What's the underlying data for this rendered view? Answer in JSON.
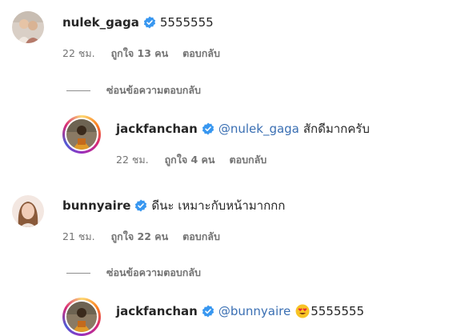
{
  "comments": [
    {
      "username": "nulek_gaga",
      "text": "5555555",
      "time": "22 ชม.",
      "likes": "ถูกใจ 13 คน",
      "reply": "ตอบกลับ",
      "hide_replies": "ซ่อนข้อความตอบกลับ",
      "replies": [
        {
          "username": "jackfanchan",
          "mention": "@nulek_gaga",
          "text": "สักดีมากครับ",
          "time": "22 ชม.",
          "likes": "ถูกใจ 4 คน",
          "reply": "ตอบกลับ"
        }
      ]
    },
    {
      "username": "bunnyaire",
      "text": "ดีนะ เหมาะกับหน้ามากกก",
      "time": "21 ชม.",
      "likes": "ถูกใจ 22 คน",
      "reply": "ตอบกลับ",
      "hide_replies": "ซ่อนข้อความตอบกลับ",
      "replies": [
        {
          "username": "jackfanchan",
          "mention": "@bunnyaire",
          "emoji": "heart-eyes-emoji",
          "text": "5555555"
        }
      ]
    }
  ],
  "colors": {
    "verified": "#3897f0",
    "mention": "#3a6fb3",
    "meta": "#737373",
    "text": "#262626"
  }
}
